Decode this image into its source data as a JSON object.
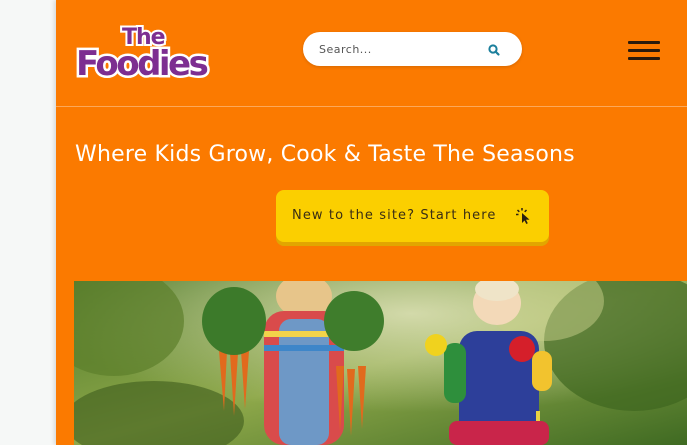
{
  "header": {
    "logo": {
      "text_top": "The",
      "text_main": "Foodies",
      "color": "#7d2e91"
    },
    "search": {
      "placeholder": "Search...",
      "icon": "search-icon"
    },
    "menu": {
      "icon": "hamburger-menu-icon"
    }
  },
  "hero": {
    "tagline": "Where Kids Grow, Cook & Taste The Seasons",
    "cta_label": "New to the site? Start here",
    "cta_icon": "pointer-click-icon",
    "image": "kids-holding-vegetables-photo"
  },
  "colors": {
    "brand_orange": "#fb7a00",
    "cta_yellow": "#fbcf00",
    "logo_purple": "#7d2e91",
    "search_icon_teal": "#1b7f9c"
  }
}
